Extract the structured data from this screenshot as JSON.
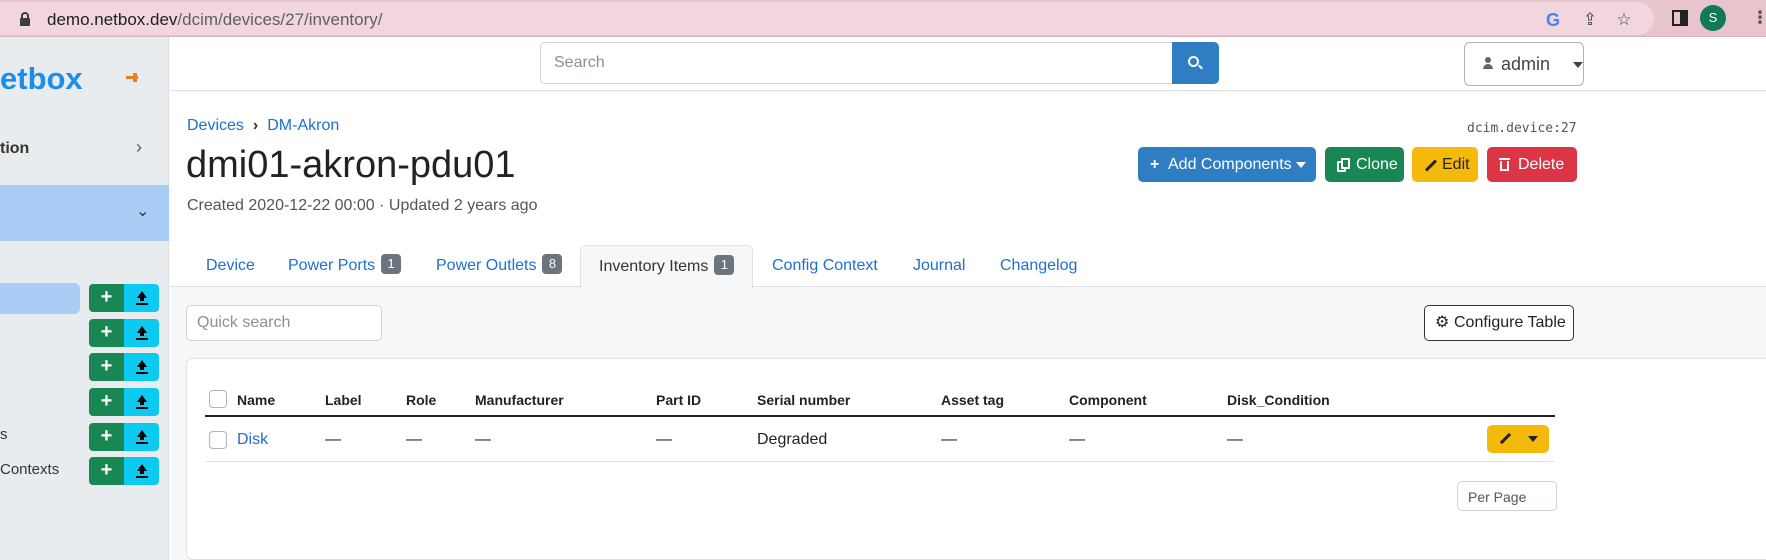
{
  "browser": {
    "url_domain": "demo.netbox.dev",
    "url_path": "/dcim/devices/27/inventory/",
    "profile_initial": "S"
  },
  "sidebar": {
    "brand": "etbox",
    "section": "tion",
    "items": [
      {
        "label": ""
      },
      {
        "label": ""
      },
      {
        "label": ""
      },
      {
        "label": ""
      },
      {
        "label": "s"
      },
      {
        "label": "Contexts"
      }
    ]
  },
  "header": {
    "search_placeholder": "Search",
    "user": "admin"
  },
  "breadcrumb": [
    "Devices",
    "DM-Akron"
  ],
  "object_id": "dcim.device:27",
  "title": "dmi01-akron-pdu01",
  "meta": "Created 2020-12-22 00:00 · Updated 2 years ago",
  "actions": {
    "add": "Add Components",
    "clone": "Clone",
    "edit": "Edit",
    "delete": "Delete"
  },
  "tabs": [
    {
      "label": "Device"
    },
    {
      "label": "Power Ports",
      "badge": "1"
    },
    {
      "label": "Power Outlets",
      "badge": "8"
    },
    {
      "label": "Inventory Items",
      "badge": "1",
      "active": true
    },
    {
      "label": "Config Context"
    },
    {
      "label": "Journal"
    },
    {
      "label": "Changelog"
    }
  ],
  "quick_search_placeholder": "Quick search",
  "configure_table": "Configure Table",
  "table": {
    "columns": [
      "Name",
      "Label",
      "Role",
      "Manufacturer",
      "Part ID",
      "Serial number",
      "Asset tag",
      "Component",
      "Disk_Condition"
    ],
    "rows": [
      [
        "Disk",
        "—",
        "—",
        "—",
        "—",
        "Degraded",
        "—",
        "—",
        "—"
      ]
    ]
  },
  "per_page": "Per Page",
  "colors": {
    "primary": "#2f7ec4",
    "success": "#198754",
    "warning": "#f5b90b",
    "danger": "#dc3545",
    "info": "#0dcaf0",
    "sidebar_active": "#a9cdf5"
  }
}
